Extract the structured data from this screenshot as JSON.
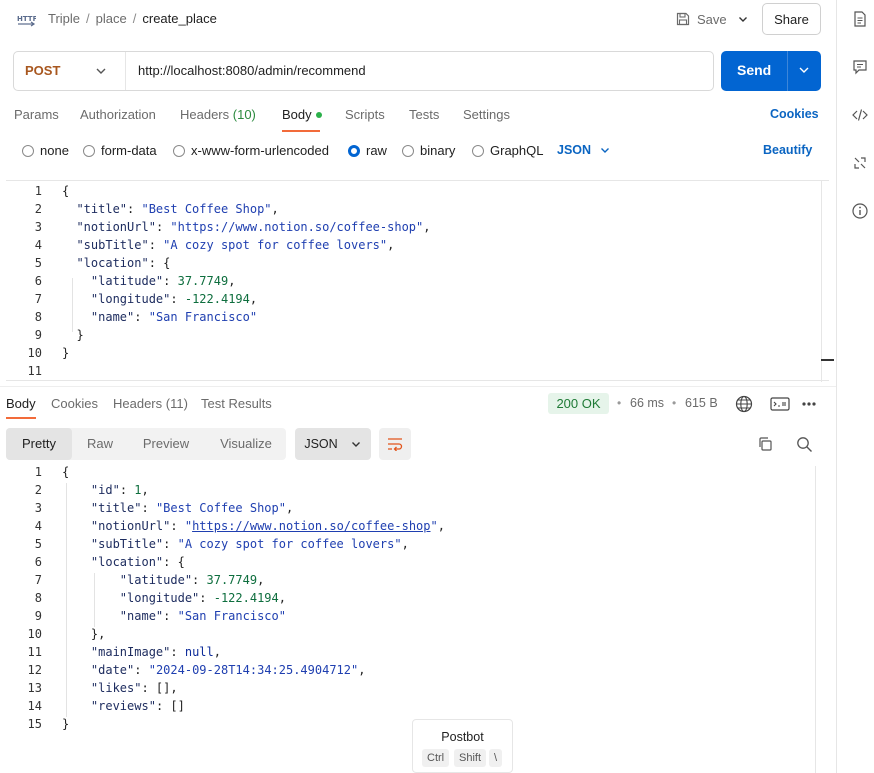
{
  "header": {
    "icon": "http-icon",
    "breadcrumb": [
      "Triple",
      "place",
      "create_place"
    ],
    "save_label": "Save",
    "share_label": "Share"
  },
  "request": {
    "method": "POST",
    "url": "http://localhost:8080/admin/recommend",
    "send_label": "Send"
  },
  "request_tabs": [
    {
      "label": "Params"
    },
    {
      "label": "Authorization"
    },
    {
      "label": "Headers",
      "count": "(10)"
    },
    {
      "label": "Body",
      "active": true
    },
    {
      "label": "Scripts"
    },
    {
      "label": "Tests"
    },
    {
      "label": "Settings"
    }
  ],
  "cookies_label": "Cookies",
  "body_types": [
    {
      "label": "none",
      "selected": false
    },
    {
      "label": "form-data",
      "selected": false
    },
    {
      "label": "x-www-form-urlencoded",
      "selected": false
    },
    {
      "label": "raw",
      "selected": true
    },
    {
      "label": "binary",
      "selected": false
    },
    {
      "label": "GraphQL",
      "selected": false
    }
  ],
  "body_format": "JSON",
  "beautify_label": "Beautify",
  "request_body_lines": [
    [
      {
        "t": "{",
        "c": "p"
      }
    ],
    [
      {
        "t": "  ",
        "c": "p"
      },
      {
        "t": "\"title\"",
        "c": "k"
      },
      {
        "t": ": ",
        "c": "p"
      },
      {
        "t": "\"Best Coffee Shop\"",
        "c": "s"
      },
      {
        "t": ",",
        "c": "p"
      }
    ],
    [
      {
        "t": "  ",
        "c": "p"
      },
      {
        "t": "\"notionUrl\"",
        "c": "k"
      },
      {
        "t": ": ",
        "c": "p"
      },
      {
        "t": "\"https://www.notion.so/coffee-shop\"",
        "c": "s"
      },
      {
        "t": ",",
        "c": "p"
      }
    ],
    [
      {
        "t": "  ",
        "c": "p"
      },
      {
        "t": "\"subTitle\"",
        "c": "k"
      },
      {
        "t": ": ",
        "c": "p"
      },
      {
        "t": "\"A cozy spot for coffee lovers\"",
        "c": "s"
      },
      {
        "t": ",",
        "c": "p"
      }
    ],
    [
      {
        "t": "  ",
        "c": "p"
      },
      {
        "t": "\"location\"",
        "c": "k"
      },
      {
        "t": ": {",
        "c": "p"
      }
    ],
    [
      {
        "t": "    ",
        "c": "p"
      },
      {
        "t": "\"latitude\"",
        "c": "k"
      },
      {
        "t": ": ",
        "c": "p"
      },
      {
        "t": "37.7749",
        "c": "n"
      },
      {
        "t": ",",
        "c": "p"
      }
    ],
    [
      {
        "t": "    ",
        "c": "p"
      },
      {
        "t": "\"longitude\"",
        "c": "k"
      },
      {
        "t": ": ",
        "c": "p"
      },
      {
        "t": "-122.4194",
        "c": "n"
      },
      {
        "t": ",",
        "c": "p"
      }
    ],
    [
      {
        "t": "    ",
        "c": "p"
      },
      {
        "t": "\"name\"",
        "c": "k"
      },
      {
        "t": ": ",
        "c": "p"
      },
      {
        "t": "\"San Francisco\"",
        "c": "s"
      }
    ],
    [
      {
        "t": "  }",
        "c": "p"
      }
    ],
    [
      {
        "t": "}",
        "c": "p"
      }
    ],
    []
  ],
  "response_tabs": [
    {
      "label": "Body",
      "active": true
    },
    {
      "label": "Cookies"
    },
    {
      "label": "Headers (11)"
    },
    {
      "label": "Test Results"
    }
  ],
  "response_meta": {
    "status": "200 OK",
    "time": "66 ms",
    "size": "615 B",
    "status_color": "#1f7a36"
  },
  "view_tabs": [
    {
      "label": "Pretty",
      "active": true
    },
    {
      "label": "Raw"
    },
    {
      "label": "Preview"
    },
    {
      "label": "Visualize"
    }
  ],
  "response_format": "JSON",
  "response_body_lines": [
    [
      {
        "t": "{",
        "c": "p"
      }
    ],
    [
      {
        "t": "    ",
        "c": "p"
      },
      {
        "t": "\"id\"",
        "c": "k"
      },
      {
        "t": ": ",
        "c": "p"
      },
      {
        "t": "1",
        "c": "n"
      },
      {
        "t": ",",
        "c": "p"
      }
    ],
    [
      {
        "t": "    ",
        "c": "p"
      },
      {
        "t": "\"title\"",
        "c": "k"
      },
      {
        "t": ": ",
        "c": "p"
      },
      {
        "t": "\"Best Coffee Shop\"",
        "c": "s"
      },
      {
        "t": ",",
        "c": "p"
      }
    ],
    [
      {
        "t": "    ",
        "c": "p"
      },
      {
        "t": "\"notionUrl\"",
        "c": "k"
      },
      {
        "t": ": ",
        "c": "p"
      },
      {
        "t": "\"",
        "c": "s"
      },
      {
        "t": "https://www.notion.so/coffee-shop",
        "c": "s u"
      },
      {
        "t": "\"",
        "c": "s"
      },
      {
        "t": ",",
        "c": "p"
      }
    ],
    [
      {
        "t": "    ",
        "c": "p"
      },
      {
        "t": "\"subTitle\"",
        "c": "k"
      },
      {
        "t": ": ",
        "c": "p"
      },
      {
        "t": "\"A cozy spot for coffee lovers\"",
        "c": "s"
      },
      {
        "t": ",",
        "c": "p"
      }
    ],
    [
      {
        "t": "    ",
        "c": "p"
      },
      {
        "t": "\"location\"",
        "c": "k"
      },
      {
        "t": ": {",
        "c": "p"
      }
    ],
    [
      {
        "t": "        ",
        "c": "p"
      },
      {
        "t": "\"latitude\"",
        "c": "k"
      },
      {
        "t": ": ",
        "c": "p"
      },
      {
        "t": "37.7749",
        "c": "n"
      },
      {
        "t": ",",
        "c": "p"
      }
    ],
    [
      {
        "t": "        ",
        "c": "p"
      },
      {
        "t": "\"longitude\"",
        "c": "k"
      },
      {
        "t": ": ",
        "c": "p"
      },
      {
        "t": "-122.4194",
        "c": "n"
      },
      {
        "t": ",",
        "c": "p"
      }
    ],
    [
      {
        "t": "        ",
        "c": "p"
      },
      {
        "t": "\"name\"",
        "c": "k"
      },
      {
        "t": ": ",
        "c": "p"
      },
      {
        "t": "\"San Francisco\"",
        "c": "s"
      }
    ],
    [
      {
        "t": "    },",
        "c": "p"
      }
    ],
    [
      {
        "t": "    ",
        "c": "p"
      },
      {
        "t": "\"mainImage\"",
        "c": "k"
      },
      {
        "t": ": ",
        "c": "p"
      },
      {
        "t": "null",
        "c": "kw"
      },
      {
        "t": ",",
        "c": "p"
      }
    ],
    [
      {
        "t": "    ",
        "c": "p"
      },
      {
        "t": "\"date\"",
        "c": "k"
      },
      {
        "t": ": ",
        "c": "p"
      },
      {
        "t": "\"2024-09-28T14:34:25.4904712\"",
        "c": "s"
      },
      {
        "t": ",",
        "c": "p"
      }
    ],
    [
      {
        "t": "    ",
        "c": "p"
      },
      {
        "t": "\"likes\"",
        "c": "k"
      },
      {
        "t": ": [],",
        "c": "p"
      }
    ],
    [
      {
        "t": "    ",
        "c": "p"
      },
      {
        "t": "\"reviews\"",
        "c": "k"
      },
      {
        "t": ": []",
        "c": "p"
      }
    ],
    [
      {
        "t": "}",
        "c": "p"
      }
    ]
  ],
  "postbot": {
    "title": "Postbot",
    "keys": [
      "Ctrl",
      "Shift",
      "\\"
    ]
  },
  "colors": {
    "send_button": "#0265d2",
    "method": "#a8571f",
    "active_tab_underline": "#f26b3a",
    "link": "#0b65c2"
  }
}
